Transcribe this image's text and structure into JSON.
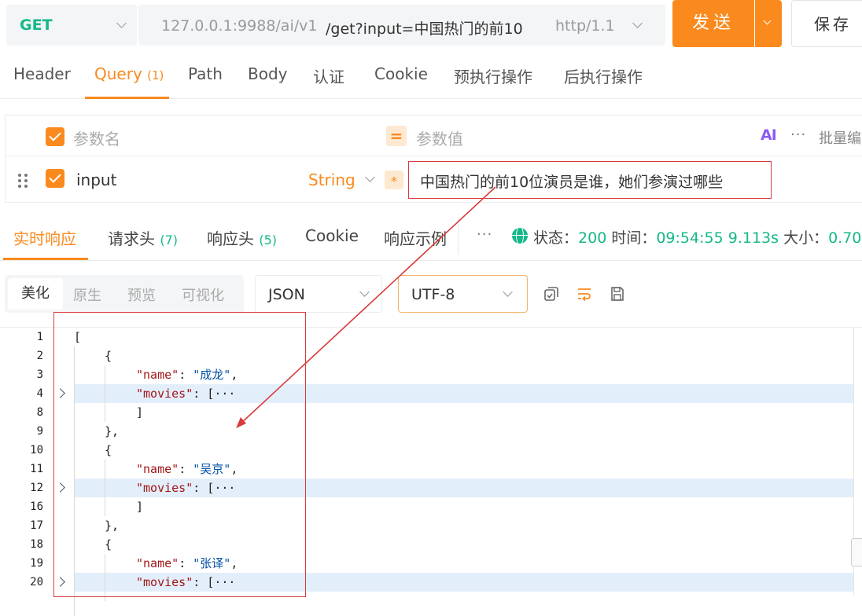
{
  "request": {
    "method": "GET",
    "url_host": "127.0.0.1:9988/ai/v1",
    "url_path": "/get?input=中国热门的前10",
    "protocol": "http/1.1",
    "send_label": "发送",
    "save_label": "保存"
  },
  "request_tabs": [
    {
      "label": "Header"
    },
    {
      "label": "Query",
      "count": "(1)"
    },
    {
      "label": "Path"
    },
    {
      "label": "Body"
    },
    {
      "label": "认证"
    },
    {
      "label": "Cookie"
    },
    {
      "label": "预执行操作"
    },
    {
      "label": "后执行操作"
    }
  ],
  "params": {
    "name_placeholder": "参数名",
    "value_placeholder": "参数值",
    "ai_label": "AI",
    "more": "···",
    "batch_edit": "批量编辑",
    "row": {
      "name": "input",
      "type": "String",
      "required_mark": "*",
      "value": "中国热门的前10位演员是谁，她们参演过哪些"
    }
  },
  "response_tabs": [
    {
      "label": "实时响应"
    },
    {
      "label": "请求头",
      "count": "(7)"
    },
    {
      "label": "响应头",
      "count": "(5)"
    },
    {
      "label": "Cookie"
    },
    {
      "label": "响应示例"
    }
  ],
  "response_more": "···",
  "status": {
    "status_label": "状态：",
    "status_value": "200",
    "time_label": "时间：",
    "time_value": "09:54:55",
    "duration": "9.113s",
    "size_label": "大小：",
    "size_value": "0.70"
  },
  "format_tabs": [
    "美化",
    "原生",
    "预览",
    "可视化"
  ],
  "content_type": "JSON",
  "encoding": "UTF-8",
  "icons": {
    "copy": "copy-icon",
    "wrap": "wrap-icon",
    "save": "save-icon",
    "globe": "globe-icon"
  },
  "colors": {
    "accent": "#fa8a1e",
    "success": "#15b88a",
    "annotation": "#d83b3b",
    "highlight": "#e3eefb"
  },
  "code_lines": [
    {
      "n": "1",
      "parts": [
        {
          "t": "["
        }
      ]
    },
    {
      "n": "2",
      "parts": [
        {
          "t": "{"
        }
      ]
    },
    {
      "n": "3",
      "parts": [
        {
          "t": "\"name\"",
          "c": "k"
        },
        {
          "t": ": "
        },
        {
          "t": "\"成龙\"",
          "c": "s"
        },
        {
          "t": ","
        }
      ]
    },
    {
      "n": "4",
      "parts": [
        {
          "t": "\"movies\"",
          "c": "k"
        },
        {
          "t": ": [···"
        }
      ]
    },
    {
      "n": "8",
      "parts": [
        {
          "t": "]"
        }
      ]
    },
    {
      "n": "9",
      "parts": [
        {
          "t": "},"
        }
      ]
    },
    {
      "n": "10",
      "parts": [
        {
          "t": "{"
        }
      ]
    },
    {
      "n": "11",
      "parts": [
        {
          "t": "\"name\"",
          "c": "k"
        },
        {
          "t": ": "
        },
        {
          "t": "\"吴京\"",
          "c": "s"
        },
        {
          "t": ","
        }
      ]
    },
    {
      "n": "12",
      "parts": [
        {
          "t": "\"movies\"",
          "c": "k"
        },
        {
          "t": ": [···"
        }
      ]
    },
    {
      "n": "16",
      "parts": [
        {
          "t": "]"
        }
      ]
    },
    {
      "n": "17",
      "parts": [
        {
          "t": "},"
        }
      ]
    },
    {
      "n": "18",
      "parts": [
        {
          "t": "{"
        }
      ]
    },
    {
      "n": "19",
      "parts": [
        {
          "t": "\"name\"",
          "c": "k"
        },
        {
          "t": ": "
        },
        {
          "t": "\"张译\"",
          "c": "s"
        },
        {
          "t": ","
        }
      ]
    },
    {
      "n": "20",
      "parts": [
        {
          "t": "\"movies\"",
          "c": "k"
        },
        {
          "t": ": [···"
        }
      ]
    }
  ]
}
